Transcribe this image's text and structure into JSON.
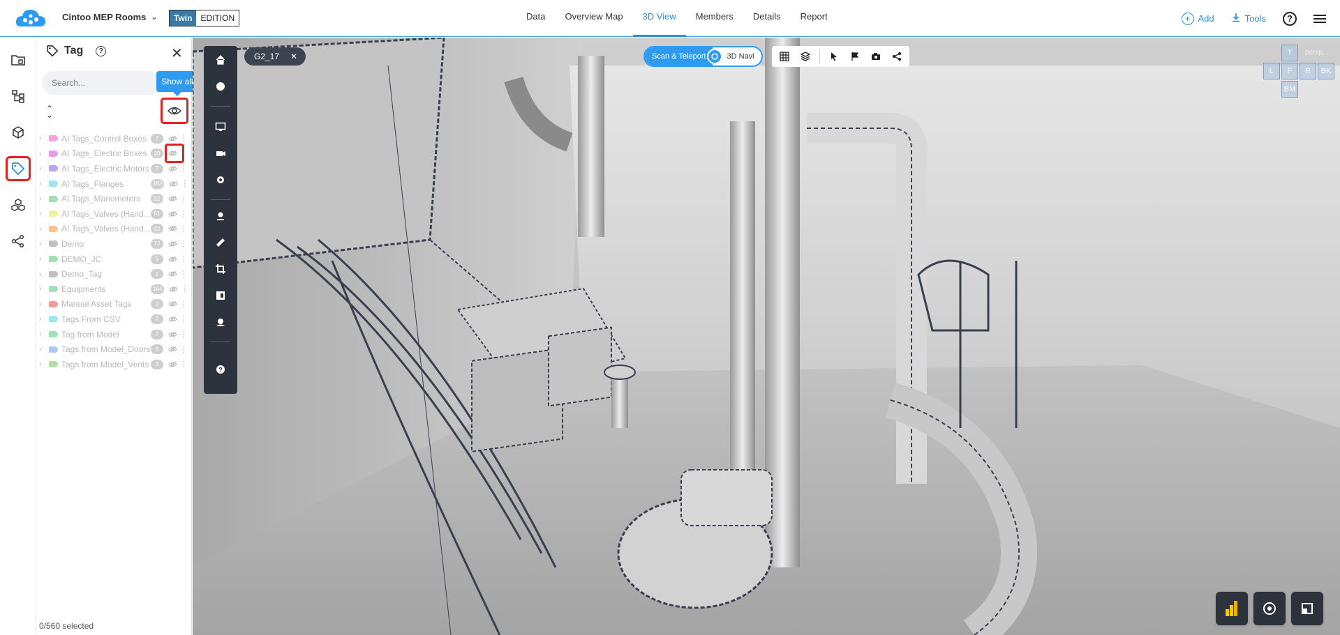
{
  "header": {
    "project_name": "Cintoo MEP Rooms",
    "edition_twin": "Twin",
    "edition_label": "EDITION",
    "tabs": [
      "Data",
      "Overview Map",
      "3D View",
      "Members",
      "Details",
      "Report"
    ],
    "active_tab": "3D View",
    "add_label": "Add",
    "tools_label": "Tools"
  },
  "tag_panel": {
    "title": "Tag",
    "search_placeholder": "Search...",
    "show_all_tooltip": "Show all",
    "footer": "0/560 selected",
    "tags": [
      {
        "name": "AI Tags_Control Boxes",
        "count": "7",
        "color": "#f3a6e0"
      },
      {
        "name": "AI Tags_Electric Boxes",
        "count": "30",
        "color": "#e89ae6"
      },
      {
        "name": "AI Tags_Electric Motors",
        "count": "7",
        "color": "#b9a4f2"
      },
      {
        "name": "AI Tags_Flanges",
        "count": "183",
        "color": "#9de6f0"
      },
      {
        "name": "AI Tags_Manometers",
        "count": "22",
        "color": "#9fe0b4"
      },
      {
        "name": "AI Tags_Valves (Hand...",
        "count": "51",
        "color": "#f2f09a"
      },
      {
        "name": "AI Tags_Valves (Hand...",
        "count": "22",
        "color": "#f7c49a"
      },
      {
        "name": "Demo",
        "count": "72",
        "color": "#c0c0c0"
      },
      {
        "name": "DEMO_JC",
        "count": "5",
        "color": "#9fe0b4"
      },
      {
        "name": "Demo_Tag",
        "count": "1",
        "color": "#c0c0c0"
      },
      {
        "name": "Equipments",
        "count": "164",
        "color": "#9fe0b4"
      },
      {
        "name": "Manual Asset Tags",
        "count": "3",
        "color": "#f39a9a"
      },
      {
        "name": "Tags From CSV",
        "count": "7",
        "color": "#9de6f0"
      },
      {
        "name": "Tag from Model",
        "count": "7",
        "color": "#9fe0b4"
      },
      {
        "name": "Tags from Model_Doors",
        "count": "6",
        "color": "#a8c8f2"
      },
      {
        "name": "Tags from Model_Vents",
        "count": "3",
        "color": "#b4e09f"
      }
    ]
  },
  "viewport": {
    "scan_name": "G2_17",
    "mode_active": "Scan & Teleport",
    "mode_other": "3D Navi",
    "cube_faces": {
      "top": "T",
      "left": "L",
      "front": "F",
      "right": "R",
      "back": "BK",
      "bottom": "BM",
      "persp": "persp."
    }
  }
}
